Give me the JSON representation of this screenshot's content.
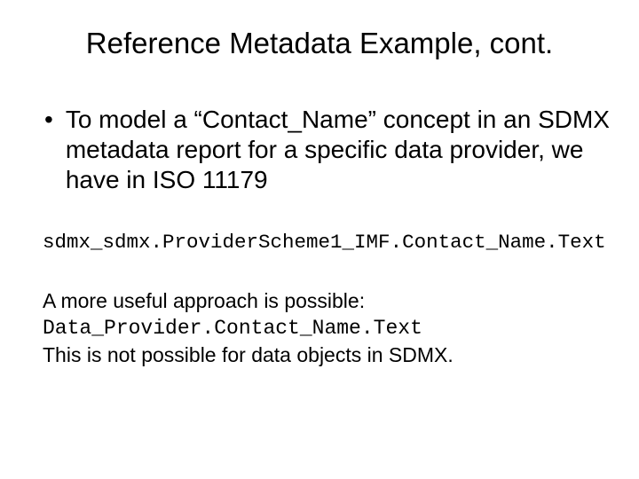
{
  "title": "Reference Metadata Example, cont.",
  "bullet": "To model a “Contact_Name” concept in an SDMX metadata report for a specific data provider, we have in ISO 11179",
  "code1": "sdmx_sdmx.ProviderScheme1_IMF.Contact_Name.Text",
  "line1": "A more useful approach is possible:",
  "code2": "Data_Provider.Contact_Name.Text",
  "line2": "This is not possible for data objects in SDMX."
}
